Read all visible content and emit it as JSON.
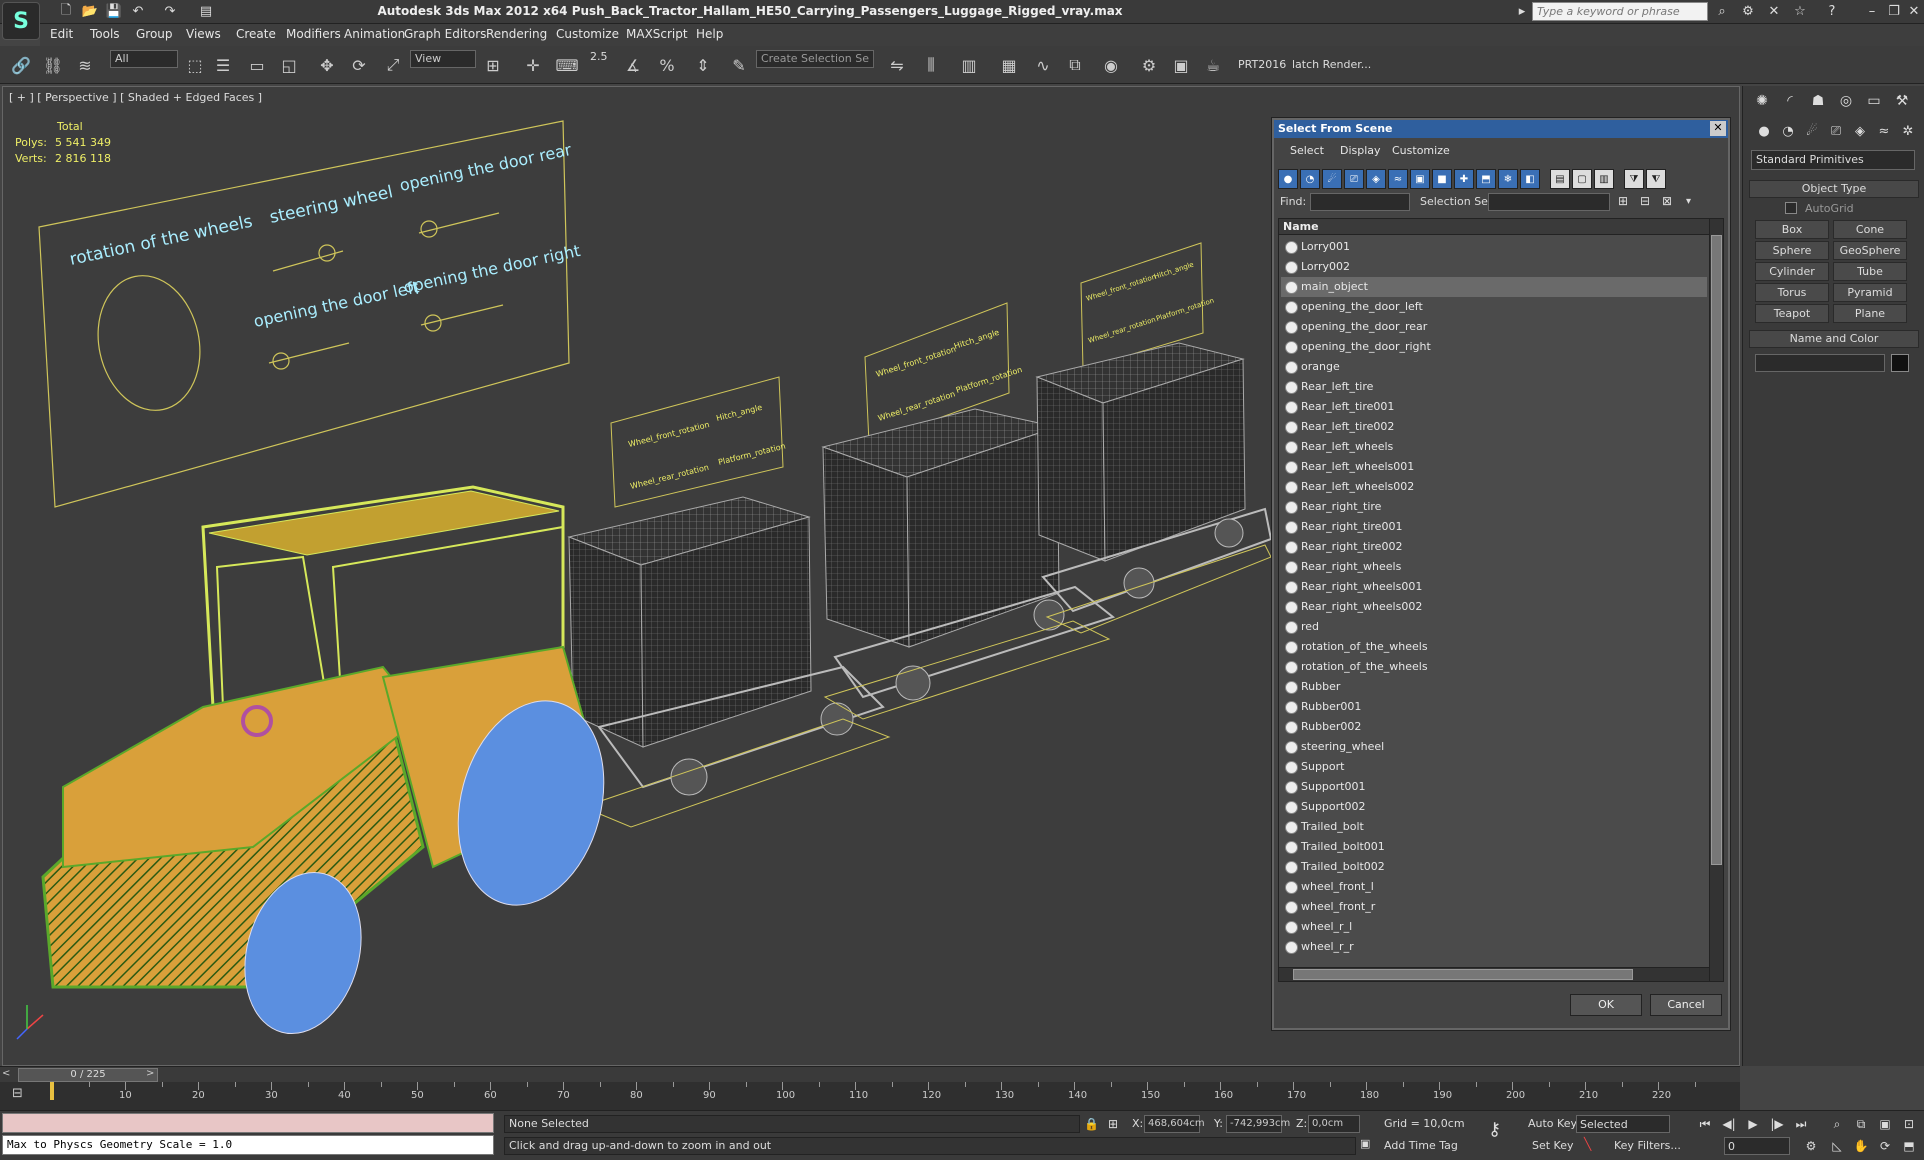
{
  "app": {
    "title": "Autodesk 3ds Max  2012 x64     Push_Back_Tractor_Hallam_HE50_Carrying_Passengers_Luggage_Rigged_vray.max",
    "search_placeholder": "Type a keyword or phrase"
  },
  "menu": [
    "Edit",
    "Tools",
    "Group",
    "Views",
    "Create",
    "Modifiers",
    "Animation",
    "Graph Editors",
    "Rendering",
    "Customize",
    "MAXScript",
    "Help"
  ],
  "toolbar": {
    "filter_value": "All",
    "refcoord_value": "View",
    "snap_value": "2.5",
    "selset_placeholder": "Create Selection Se",
    "prt_label": "PRT2016",
    "batch_label": "latch Render..."
  },
  "viewport": {
    "label": "[ + ] [ Perspective ] [ Shaded + Edged Faces ]",
    "stats": {
      "header": "Total",
      "polys_label": "Polys:",
      "polys": "5 541 349",
      "verts_label": "Verts:",
      "verts": "2 816 118"
    },
    "panel_labels": [
      "rotation of the wheels",
      "steering wheel",
      "opening the door rear",
      "opening the door left",
      "opening the door right"
    ],
    "cart_labels": [
      [
        "Wheel_front_rotation",
        "Hitch_angle",
        "Wheel_rear_rotation",
        "Platform_rotation"
      ],
      [
        "Wheel_front_rotation",
        "Hitch_angle",
        "Wheel_rear_rotation",
        "Platform_rotation"
      ],
      [
        "Wheel_front_rotation",
        "Hitch_angle",
        "Wheel_rear_rotation",
        "Platform_rotation"
      ]
    ],
    "colors": {
      "cab": "#d6e85a",
      "body": "#d9a03a",
      "frame": "#5aa82a",
      "tire": "#5b8fe0",
      "wire": "#cfc55a",
      "cart": "#bbbbbb"
    }
  },
  "command_panel": {
    "combo": "Standard Primitives",
    "object_type_header": "Object Type",
    "autogrid": "AutoGrid",
    "buttons": [
      "Box",
      "Cone",
      "Sphere",
      "GeoSphere",
      "Cylinder",
      "Tube",
      "Torus",
      "Pyramid",
      "Teapot",
      "Plane"
    ],
    "name_color_header": "Name and Color"
  },
  "dialog": {
    "title": "Select From Scene",
    "menu": [
      "Select",
      "Display",
      "Customize"
    ],
    "find_label": "Find:",
    "selset_label": "Selection Set:",
    "column": "Name",
    "items": [
      "Lorry001",
      "Lorry002",
      "main_object",
      "opening_the_door_left",
      "opening_the_door_rear",
      "opening_the_door_right",
      "orange",
      "Rear_left_tire",
      "Rear_left_tire001",
      "Rear_left_tire002",
      "Rear_left_wheels",
      "Rear_left_wheels001",
      "Rear_left_wheels002",
      "Rear_right_tire",
      "Rear_right_tire001",
      "Rear_right_tire002",
      "Rear_right_wheels",
      "Rear_right_wheels001",
      "Rear_right_wheels002",
      "red",
      "rotation_of_the_wheels",
      "rotation_of_the_wheels",
      "Rubber",
      "Rubber001",
      "Rubber002",
      "steering_wheel",
      "Support",
      "Support001",
      "Support002",
      "Trailed_bolt",
      "Trailed_bolt001",
      "Trailed_bolt002",
      "wheel_front_l",
      "wheel_front_r",
      "wheel_r_l",
      "wheel_r_r"
    ],
    "selected_index": 2,
    "ok": "OK",
    "cancel": "Cancel"
  },
  "timeline": {
    "frame": "0 / 225",
    "ticks": [
      "10",
      "20",
      "30",
      "40",
      "50",
      "60",
      "70",
      "80",
      "90",
      "100",
      "110",
      "120",
      "130",
      "140",
      "150",
      "160",
      "170",
      "180",
      "190",
      "200",
      "210",
      "220"
    ]
  },
  "status": {
    "script": "Max to Physcs Geometry Scale = 1.0",
    "selection": "None Selected",
    "message": "Click and drag up-and-down to zoom in and out",
    "x_label": "X:",
    "x": "468,604cm",
    "y_label": "Y:",
    "y": "-742,993cm",
    "z_label": "Z:",
    "z": "0,0cm",
    "grid": "Grid = 10,0cm",
    "add_time_tag": "Add Time Tag",
    "auto_key": "Auto Key",
    "set_key": "Set Key",
    "key_mode": "Selected",
    "key_filters": "Key Filters...",
    "frame_value": "0"
  }
}
